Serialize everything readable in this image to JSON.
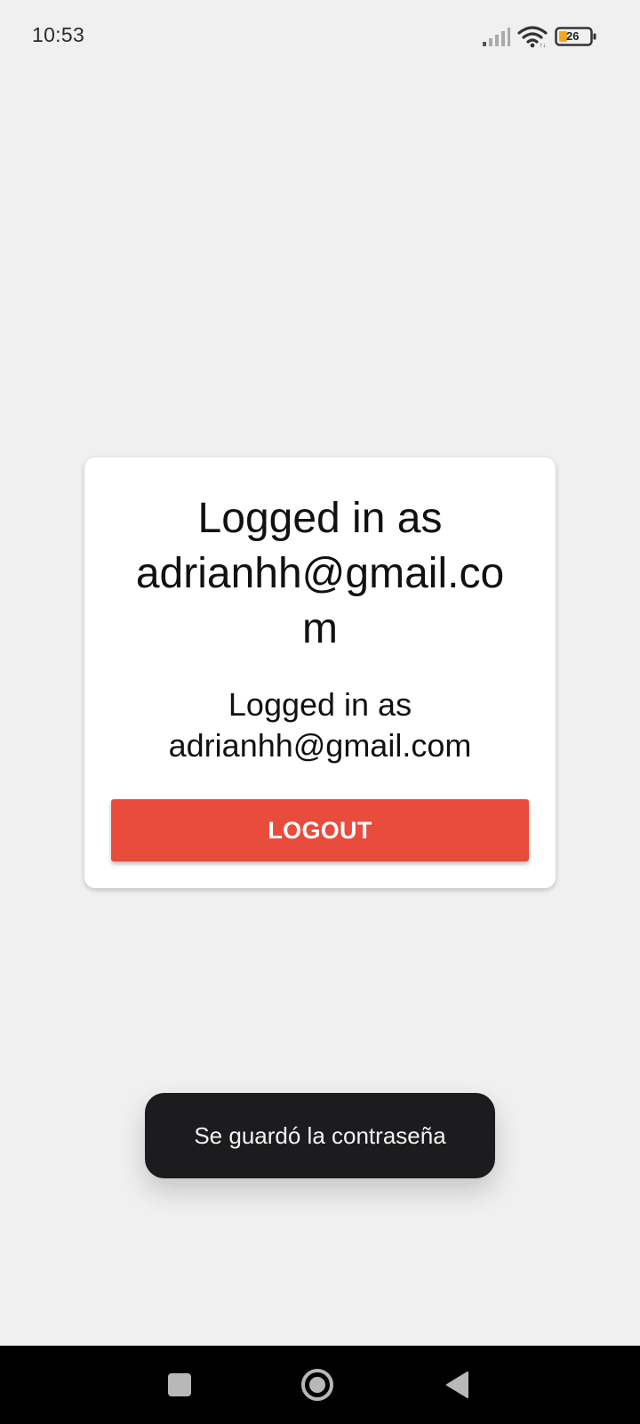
{
  "status_bar": {
    "time": "10:53",
    "battery_level": "26",
    "icons": [
      "signal-icon",
      "wifi-icon",
      "battery-icon"
    ]
  },
  "card": {
    "title": "Logged in as adrianhh@gmail.com",
    "subtitle_line1": "Logged in as",
    "subtitle_line2": "adrianhh@gmail.com",
    "logout_label": "LOGOUT"
  },
  "toast": {
    "message": "Se guardó la contraseña"
  },
  "nav_bar": {
    "buttons": [
      "recents-icon",
      "home-icon",
      "back-icon"
    ]
  },
  "colors": {
    "background": "#f0f0f0",
    "card": "#ffffff",
    "logout_button": "#e84c3d",
    "toast": "#1c1c1e",
    "nav_bar": "#000000",
    "battery_fill": "#f5a623"
  }
}
